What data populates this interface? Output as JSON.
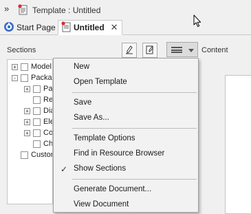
{
  "window": {
    "title": "Template : Untitled"
  },
  "tabs": [
    {
      "label": "Start Page",
      "active": false
    },
    {
      "label": "Untitled",
      "active": true
    }
  ],
  "panel": {
    "sections_label": "Sections",
    "content_label": "Content"
  },
  "tree": [
    {
      "label": "Model",
      "expander": "+"
    },
    {
      "label": "Package",
      "expander": "-"
    },
    {
      "label": "Pa",
      "expander": "+"
    },
    {
      "label": "Re",
      "expander": ""
    },
    {
      "label": "Dia",
      "expander": "+"
    },
    {
      "label": "Ele",
      "expander": "+"
    },
    {
      "label": "Co",
      "expander": "+"
    },
    {
      "label": "Ch",
      "expander": ""
    },
    {
      "label": "Custom",
      "expander": ""
    }
  ],
  "menu": {
    "items": [
      {
        "label": "New",
        "checked": false
      },
      {
        "label": "Open Template",
        "checked": false
      },
      {
        "label": "Save",
        "checked": false
      },
      {
        "label": "Save As...",
        "checked": false
      },
      {
        "label": "Template Options",
        "checked": false
      },
      {
        "label": "Find in Resource Browser",
        "checked": false
      },
      {
        "label": "Show Sections",
        "checked": true
      },
      {
        "label": "Generate Document...",
        "checked": false
      },
      {
        "label": "View Document",
        "checked": false
      }
    ],
    "check_glyph": "✓"
  },
  "icons": {
    "chevrons": "»",
    "close": "✕"
  },
  "colors": {
    "accent_blue": "#3b6fc4",
    "menu_background": "#f2f2f2",
    "tab_active_background": "#ffffff"
  }
}
